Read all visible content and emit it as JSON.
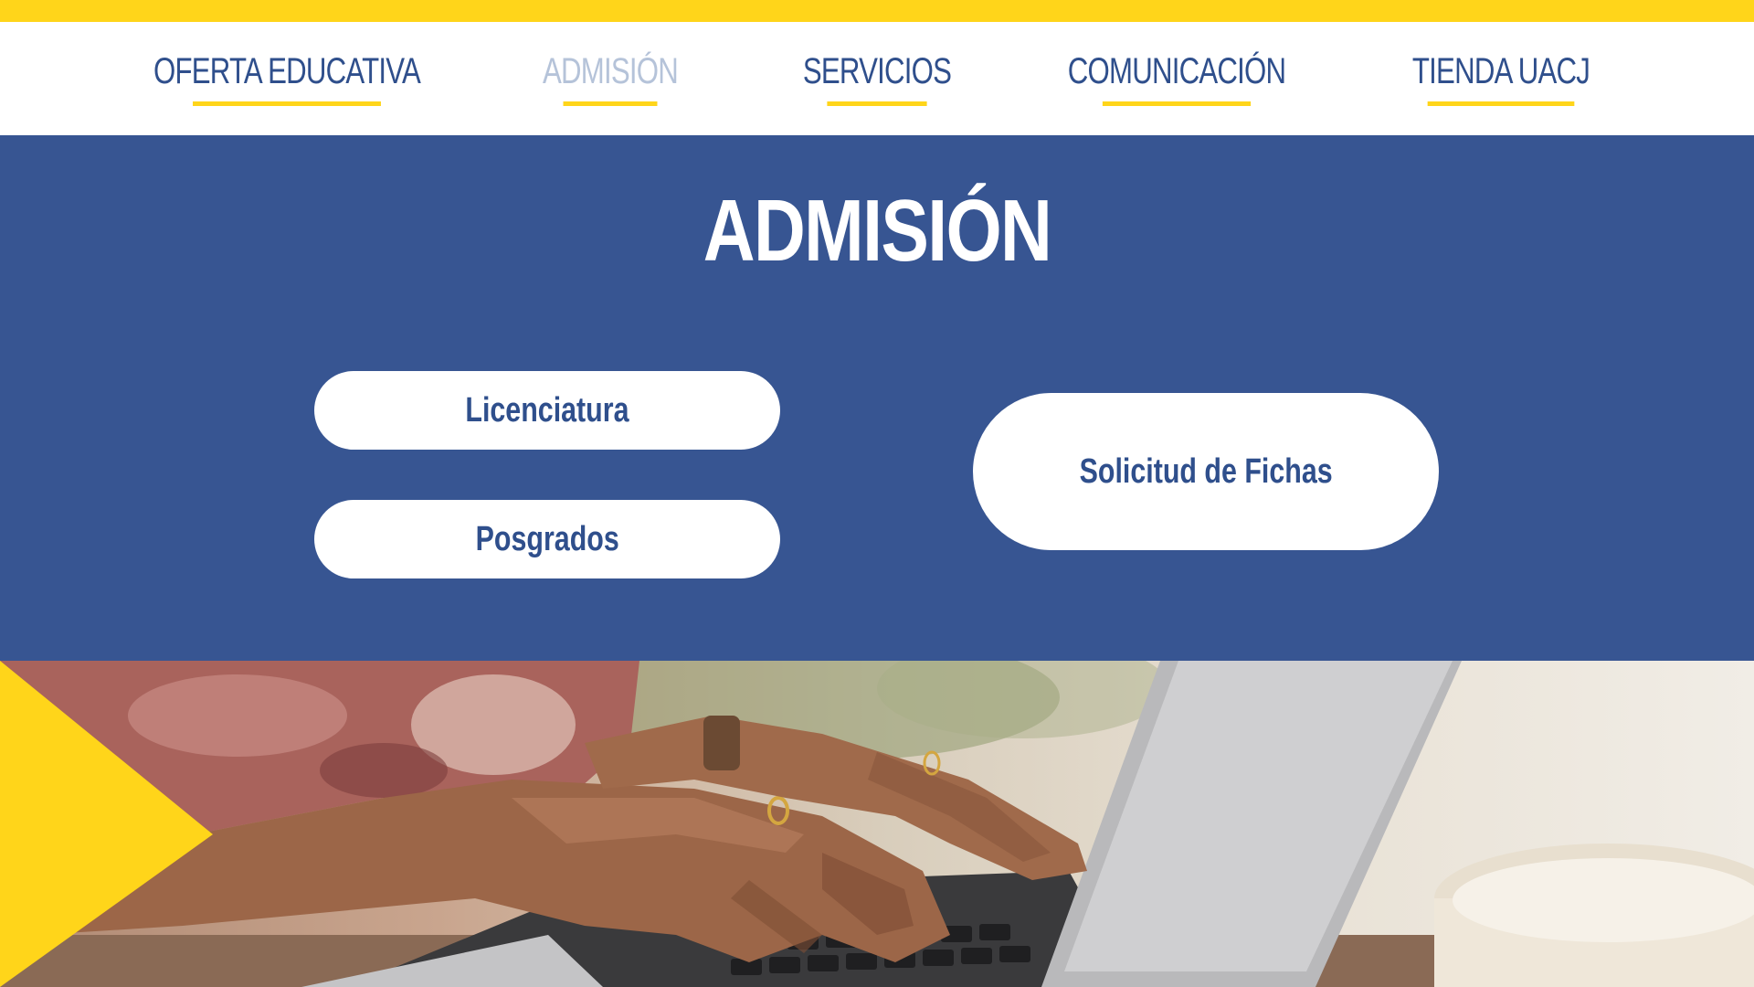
{
  "nav": {
    "items": [
      {
        "label": "OFERTA EDUCATIVA"
      },
      {
        "label": "ADMISIÓN"
      },
      {
        "label": "SERVICIOS"
      },
      {
        "label": "COMUNICACIÓN"
      },
      {
        "label": "TIENDA UACJ"
      }
    ],
    "active": "ADMISIÓN"
  },
  "hero": {
    "title": "ADMISIÓN",
    "buttons": {
      "licenciatura": "Licenciatura",
      "posgrados": "Posgrados",
      "solicitud": "Solicitud de Fichas"
    }
  },
  "colors": {
    "brand_blue": "#375592",
    "accent_yellow": "#FFD51A",
    "nav_text": "#2F4F8C",
    "nav_active_text": "#B5C3D9",
    "white": "#FFFFFF"
  },
  "photo": {
    "subject": "hands typing on a laptop keyboard"
  }
}
